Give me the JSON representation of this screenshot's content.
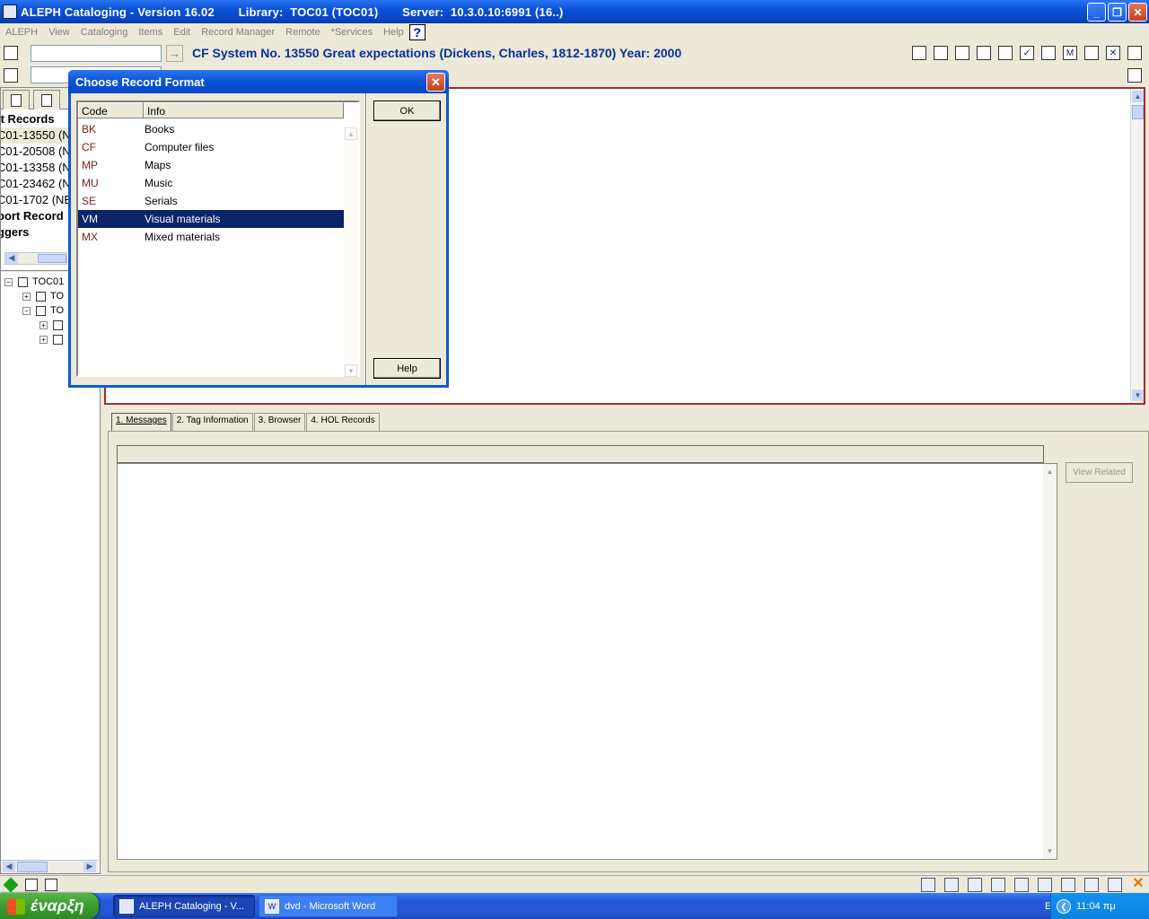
{
  "window": {
    "title": "ALEPH Cataloging - Version 16.02       Library:  TOC01 (TOC01)       Server:  10.3.0.10:6991 (16..)",
    "controls": [
      "minimize",
      "restore",
      "close"
    ]
  },
  "menu": {
    "items": [
      "ALEPH",
      "View",
      "Cataloging",
      "Items",
      "Edit",
      "Record Manager",
      "Remote",
      "*Services",
      "Help"
    ],
    "help_icon": "?"
  },
  "toolbar": {
    "command_value": "",
    "record_header": "CF System No. 13550 Great expectations (Dickens, Charles, 1812-1870) Year: 2000"
  },
  "left_panel": {
    "list": [
      {
        "text": "it Records",
        "header": true
      },
      {
        "text": "C01-13550 (N",
        "selected": true
      },
      {
        "text": "C01-20508 (N"
      },
      {
        "text": "C01-13358 (N"
      },
      {
        "text": "C01-23462 (N"
      },
      {
        "text": "C01-1702 (NE"
      },
      {
        "text": "port Record",
        "header": true
      },
      {
        "text": "ggers",
        "header": true
      }
    ],
    "tree": [
      {
        "label": "TOC01",
        "level": 0,
        "expander": "−"
      },
      {
        "label": "TO",
        "level": 1,
        "expander": "+"
      },
      {
        "label": "TO",
        "level": 1,
        "expander": "−"
      },
      {
        "label": "",
        "level": 2,
        "expander": "+"
      },
      {
        "label": "",
        "level": 2,
        "expander": "+"
      }
    ]
  },
  "messages": {
    "tabs": [
      "1. Messages",
      "2. Tag Information",
      "3. Browser",
      "4. HOL Records"
    ],
    "view_related": "View Related"
  },
  "dialog": {
    "title": "Choose Record Format",
    "columns": [
      "Code",
      "Info"
    ],
    "rows": [
      {
        "code": "BK",
        "info": "Books"
      },
      {
        "code": "CF",
        "info": "Computer files"
      },
      {
        "code": "MP",
        "info": "Maps"
      },
      {
        "code": "MU",
        "info": "Music"
      },
      {
        "code": "SE",
        "info": "Serials"
      },
      {
        "code": "VM",
        "info": "Visual materials",
        "selected": true
      },
      {
        "code": "MX",
        "info": "Mixed materials"
      }
    ],
    "ok_label": "OK",
    "help_label": "Help"
  },
  "taskbar": {
    "start_label": "έναρξη",
    "tasks": [
      {
        "label": "ALEPH Cataloging - V...",
        "active": true
      },
      {
        "label": "dvd - Microsoft Word",
        "active": false
      }
    ],
    "language": "EN",
    "clock": "11:04 πμ"
  },
  "colors": {
    "title_bar": "#0a52d8",
    "record_header": "#0b2f9c",
    "selection": "#0a246a",
    "code_text": "#8b1a1a",
    "editor_border": "#a0302a"
  }
}
